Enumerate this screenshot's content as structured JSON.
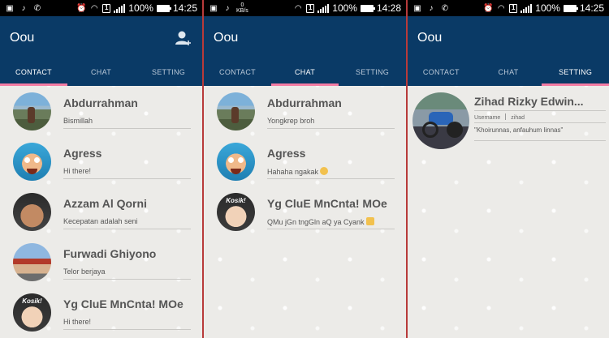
{
  "screens": [
    {
      "status": {
        "battery_pct": "100%",
        "time": "14:25",
        "speed": ""
      },
      "app_title": "Oou",
      "tabs": [
        "CONTACT",
        "CHAT",
        "SETTING"
      ],
      "active_tab": 0,
      "items": [
        {
          "name": "Abdurrahman",
          "status": "Bismillah"
        },
        {
          "name": "Agress",
          "status": "Hi there!"
        },
        {
          "name": "Azzam Al Qorni",
          "status": "Kecepatan adalah seni"
        },
        {
          "name": "Furwadi Ghiyono",
          "status": "Telor berjaya"
        },
        {
          "name": "Yg CluE MnCnta! MOe",
          "status": "Hi there!"
        }
      ]
    },
    {
      "status": {
        "battery_pct": "100%",
        "time": "14:28",
        "speed_value": "0",
        "speed_unit": "KB/s"
      },
      "app_title": "Oou",
      "tabs": [
        "CONTACT",
        "CHAT",
        "SETTING"
      ],
      "active_tab": 1,
      "items": [
        {
          "name": "Abdurrahman",
          "status": "Yongkrep broh"
        },
        {
          "name": "Agress",
          "status": "Hahaha ngakak"
        },
        {
          "name": "Yg CluE MnCnta! MOe",
          "status": "QMu jGn tngGln aQ ya Cyank"
        }
      ]
    },
    {
      "status": {
        "battery_pct": "100%",
        "time": "14:25"
      },
      "app_title": "Oou",
      "tabs": [
        "CONTACT",
        "CHAT",
        "SETTING"
      ],
      "active_tab": 2,
      "profile": {
        "name": "Zihad Rizky Edwin...",
        "username_label": "Username",
        "username": "zihad",
        "bio": "\"Khoirunnas, anfauhum linnas\""
      }
    }
  ],
  "kosik_label": "Kosik!",
  "colors": {
    "appbar": "#0a3a66",
    "tab_indicator": "#f47ca4",
    "divider": "#b83a3a"
  },
  "icons": [
    "music-note-icon",
    "whatsapp-icon",
    "alarm-icon",
    "wifi-icon",
    "sim-icon",
    "signal-icon",
    "battery-icon",
    "add-user-icon"
  ]
}
